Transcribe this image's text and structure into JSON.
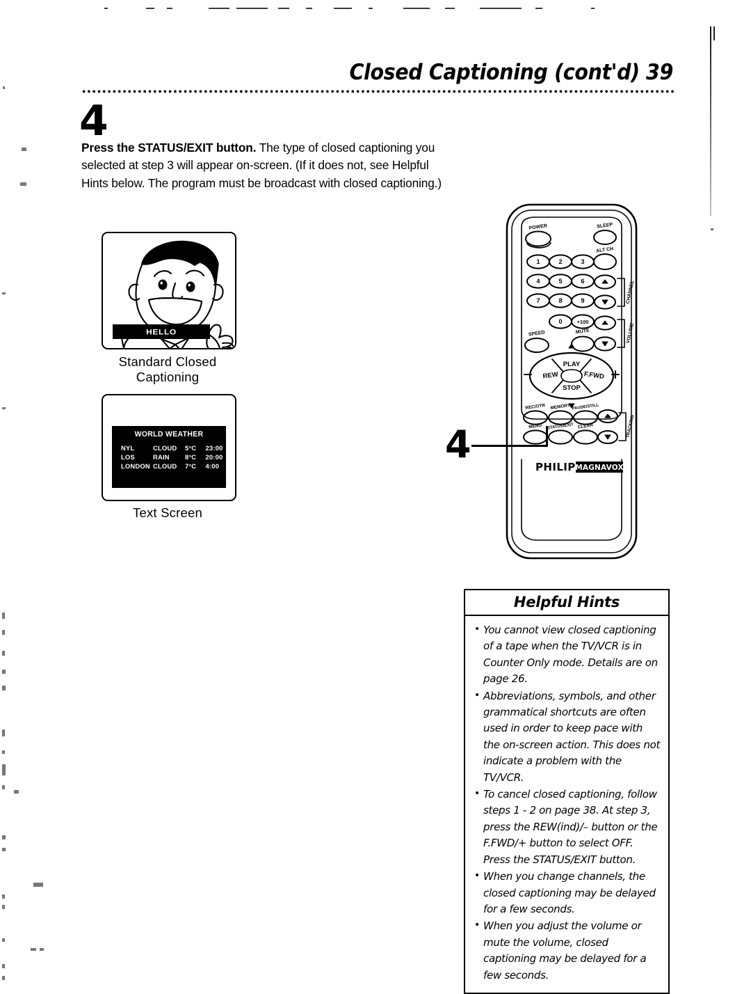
{
  "header": {
    "title": "Closed Captioning (cont'd)",
    "page_number": "39"
  },
  "step": {
    "number": "4",
    "body_lead": "Press the STATUS/EXIT button.",
    "body_rest": " The type of closed captioning you selected at step 3 will appear on-screen. (If it does not, see Helpful Hints below. The program must be broadcast with closed captioning.)"
  },
  "figures": {
    "standard_cc": {
      "caption": "Standard Closed Captioning",
      "caption_bar_text": "HELLO"
    },
    "text_screen": {
      "caption": "Text Screen",
      "screen_title": "WORLD WEATHER",
      "rows": [
        {
          "city": "NYL",
          "condition": "CLOUD",
          "temp": "5°C",
          "time": "23:00"
        },
        {
          "city": "LOS",
          "condition": "RAIN",
          "temp": "8°C",
          "time": "20:00"
        },
        {
          "city": "LONDON",
          "condition": "CLOUD",
          "temp": "7°C",
          "time": "4:00"
        }
      ]
    }
  },
  "remote": {
    "callout_number": "4",
    "brand_primary": "PHILIPS",
    "brand_secondary": "MAGNAVOX",
    "buttons": {
      "power": "POWER",
      "sleep": "SLEEP",
      "alt_ch": "ALT CH",
      "num_1": "1",
      "num_2": "2",
      "num_3": "3",
      "num_4": "4",
      "num_5": "5",
      "num_6": "6",
      "num_7": "7",
      "num_8": "8",
      "num_9": "9",
      "num_0": "0",
      "plus_100": "+100",
      "channel": "CHANNEL",
      "volume": "VOLUME",
      "speed": "SPEED",
      "mute": "MUTE",
      "play": "PLAY",
      "rew": "REW",
      "ffwd": "F.FWD",
      "stop": "STOP",
      "minus": "–",
      "plus": "+",
      "rec_otr": "REC/OTR",
      "memory": "MEMORY",
      "pause_still": "PAUSE/STILL",
      "menu": "MENU",
      "status_exit": "STATUS/EXIT",
      "clear": "CLEAR",
      "tracking": "TRACKING"
    }
  },
  "helpful_hints": {
    "title": "Helpful Hints",
    "items": [
      "You cannot view closed captioning of a tape when the TV/VCR is in Counter Only mode. Details are on page 26.",
      "Abbreviations, symbols, and other grammatical shortcuts are often used in order to keep pace with the on-screen action. This does not indicate a problem with the TV/VCR.",
      "To cancel closed captioning, follow steps 1 - 2 on page 38. At step 3, press the REW(ind)/– button or the F.FWD/+ button to select OFF. Press the STATUS/EXIT button.",
      "When you change channels, the closed captioning may be delayed for a few seconds.",
      "When you adjust the volume or mute the volume, closed captioning may be delayed for a few seconds."
    ]
  },
  "colors": {
    "ink": "#000000",
    "paper": "#ffffff",
    "screen_bg": "#000000",
    "screen_text": "#ffffff"
  }
}
